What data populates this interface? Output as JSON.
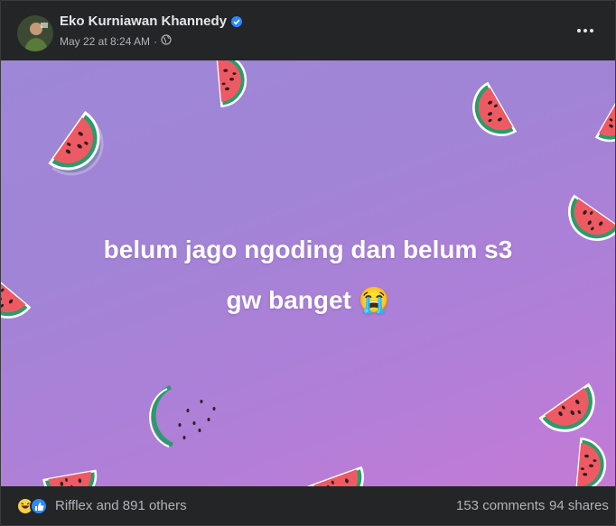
{
  "post": {
    "author": "Eko Kurniawan Khannedy",
    "date": "May 22 at 8:24 AM",
    "separator": "·",
    "privacy_icon": "globe-icon",
    "verified_icon": "verified-badge-icon",
    "more_icon": "more-options-icon"
  },
  "media": {
    "line1": "belum jago ngoding dan belum s3",
    "line2": "gw banget",
    "emoji": "😭",
    "background": "#a585d7"
  },
  "footer": {
    "reactions_text": "Rifflex and 891 others",
    "comments": "153 comments",
    "shares": "94 shares",
    "reaction_icons": [
      "haha-reaction-icon",
      "like-reaction-icon"
    ]
  },
  "colors": {
    "card_bg": "#242526",
    "text_primary": "#e4e6eb",
    "text_secondary": "#b0b3b8",
    "accent": "#2d88ff"
  }
}
